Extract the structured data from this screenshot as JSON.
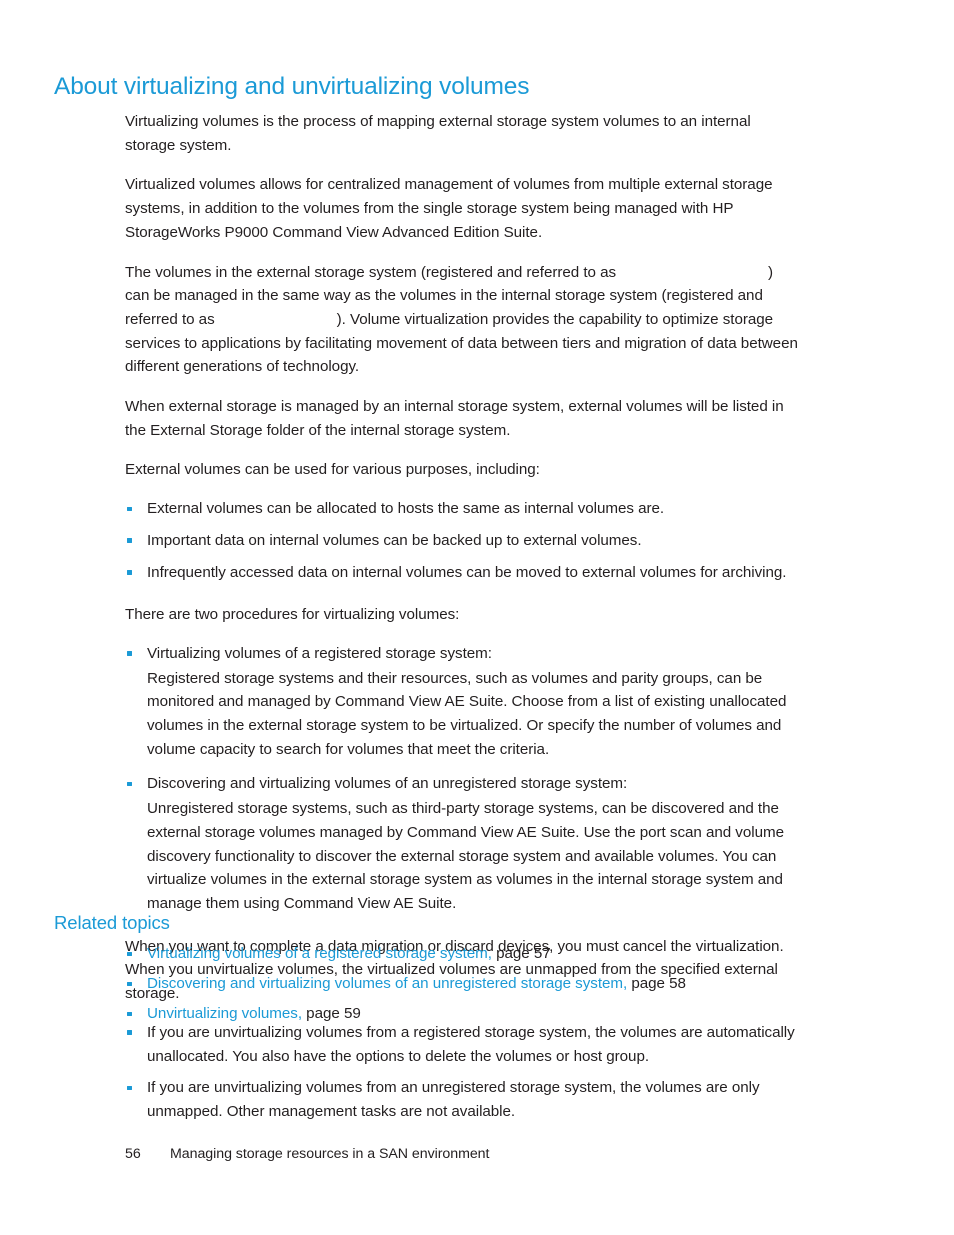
{
  "document": {
    "heading": "About virtualizing and unvirtualizing volumes",
    "paragraphs": {
      "p1": "Virtualizing volumes is the process of mapping external storage system volumes to an internal storage system.",
      "p2": "Virtualized volumes allows for centralized management of volumes from multiple external storage systems, in addition to the volumes from the single storage system being managed with HP StorageWorks P9000 Command View Advanced Edition Suite.",
      "p3_a": "The volumes in the external storage system (registered and referred to as",
      "p3_b": ") can be managed in the same way as the volumes in the internal storage system (registered and referred to as",
      "p3_c": "). Volume virtualization provides the capability to optimize storage services to applications by facilitating movement of data between tiers and migration of data between different generations of technology.",
      "p4": "When external storage is managed by an internal storage system, external volumes will be listed in the External Storage folder of the internal storage system.",
      "p5": "External volumes can be used for various purposes, including:",
      "p6": "There are two procedures for virtualizing volumes:",
      "p7": "When you want to complete a data migration or discard devices, you must cancel the virtualization. When you unvirtualize volumes, the virtualized volumes are unmapped from the specified external storage."
    },
    "purposes_list": [
      "External volumes can be allocated to hosts the same as internal volumes are.",
      "Important data on internal volumes can be backed up to external volumes.",
      "Infrequently accessed data on internal volumes can be moved to external volumes for archiving."
    ],
    "procedures": [
      {
        "title": "Virtualizing volumes of a registered storage system:",
        "body": "Registered storage systems and their resources, such as volumes and parity groups, can be monitored and managed by Command View AE Suite. Choose from a list of existing unallocated volumes in the external storage system to be virtualized. Or specify the number of volumes and volume capacity to search for volumes that meet the criteria."
      },
      {
        "title": "Discovering and virtualizing volumes of an unregistered storage system:",
        "body": "Unregistered storage systems, such as third-party storage systems, can be discovered and the external storage volumes managed by Command View AE Suite. Use the port scan and volume discovery functionality to discover the external storage system and available volumes. You can virtualize volumes in the external storage system as volumes in the internal storage system and manage them using Command View AE Suite."
      }
    ],
    "unvirtualize_list": [
      "If you are unvirtualizing volumes from a registered storage system, the volumes are automatically unallocated. You also have the options to delete the volumes or host group.",
      "If you are unvirtualizing volumes from an unregistered storage system, the volumes are only unmapped. Other management tasks are not available."
    ]
  },
  "related_topics": {
    "heading": "Related topics",
    "separator": ",",
    "items": [
      {
        "link": "Virtualizing volumes of a registered storage system",
        "page": " page 57"
      },
      {
        "link": "Discovering and virtualizing volumes of an unregistered storage system",
        "page": " page 58"
      },
      {
        "link": "Unvirtualizing volumes",
        "page": " page 59"
      }
    ]
  },
  "footer": {
    "page_number": "56",
    "chapter_title": "Managing storage resources in a SAN environment"
  },
  "colors": {
    "heading_blue": "#1b9ad6",
    "body_text": "#231f20",
    "bullet_blue": "#1b9ad6",
    "page_background": "#ffffff"
  }
}
